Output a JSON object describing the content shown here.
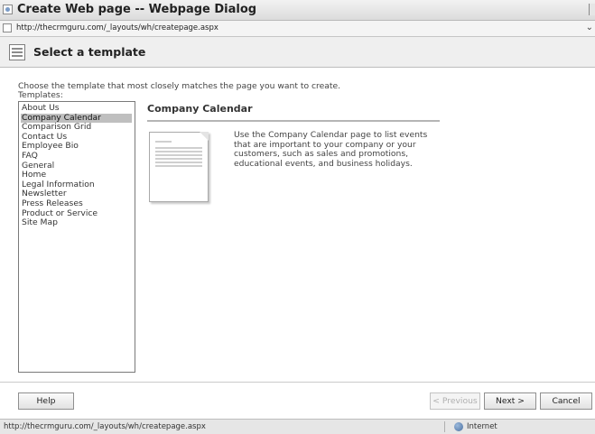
{
  "window": {
    "title": "Create Web page -- Webpage Dialog",
    "url": "http://thecrmguru.com/_layouts/wh/createpage.aspx"
  },
  "header": {
    "title": "Select a template"
  },
  "intro": "Choose the template that most closely matches the page you want to create.",
  "templates_label": "Templates:",
  "templates": [
    {
      "label": "About Us"
    },
    {
      "label": "Company Calendar"
    },
    {
      "label": "Comparison Grid"
    },
    {
      "label": "Contact Us"
    },
    {
      "label": "Employee Bio"
    },
    {
      "label": "FAQ"
    },
    {
      "label": "General"
    },
    {
      "label": "Home"
    },
    {
      "label": "Legal Information"
    },
    {
      "label": "Newsletter"
    },
    {
      "label": "Press Releases"
    },
    {
      "label": "Product or Service"
    },
    {
      "label": "Site Map"
    }
  ],
  "selected_template": "Company Calendar",
  "detail": {
    "title": "Company Calendar",
    "description": "Use the Company Calendar page to list events that are important to your company or your customers, such as sales and promotions, educational events, and business holidays."
  },
  "buttons": {
    "help": "Help",
    "previous": "< Previous",
    "next": "Next >",
    "cancel": "Cancel"
  },
  "status": {
    "url": "http://thecrmguru.com/_layouts/wh/createpage.aspx",
    "zone": "Internet"
  }
}
